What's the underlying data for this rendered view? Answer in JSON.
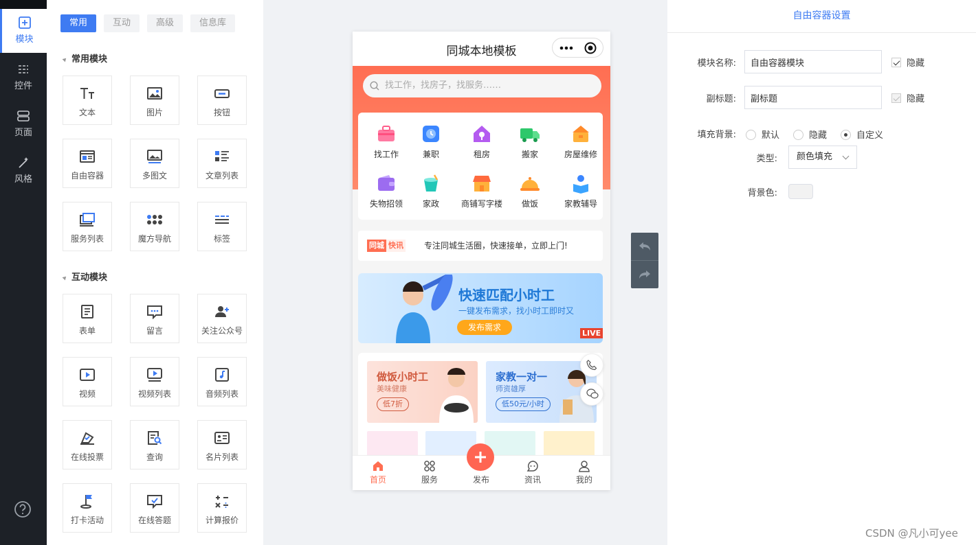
{
  "sidebar": {
    "items": [
      {
        "label": "模块",
        "icon": "plus-square-icon",
        "active": true
      },
      {
        "label": "控件",
        "icon": "sliders-icon",
        "active": false
      },
      {
        "label": "页面",
        "icon": "pages-icon",
        "active": false
      },
      {
        "label": "风格",
        "icon": "magic-wand-icon",
        "active": false
      }
    ],
    "help_icon": "help-circle-icon"
  },
  "library": {
    "tabs": [
      "常用",
      "互动",
      "高级",
      "信息库"
    ],
    "active_tab": "常用",
    "sections": [
      {
        "title": "常用模块",
        "tiles": [
          "文本",
          "图片",
          "按钮",
          "自由容器",
          "多图文",
          "文章列表",
          "服务列表",
          "魔方导航",
          "标签"
        ]
      },
      {
        "title": "互动模块",
        "tiles": [
          "表单",
          "留言",
          "关注公众号",
          "视频",
          "视频列表",
          "音频列表",
          "在线投票",
          "查询",
          "名片列表",
          "打卡活动",
          "在线答题",
          "计算报价"
        ]
      }
    ]
  },
  "phone": {
    "title": "同城本地模板",
    "search_placeholder": "找工作，找房子，找服务……",
    "categories": [
      "找工作",
      "兼职",
      "租房",
      "搬家",
      "房屋维修",
      "失物招领",
      "家政",
      "商铺写字楼",
      "做饭",
      "家教辅导"
    ],
    "news": {
      "badge_a": "同城",
      "badge_b": "快讯",
      "text": "专注同城生活圈，快速接单，立即上门!"
    },
    "banner": {
      "title": "快速匹配小时工",
      "subtitle": "一键发布需求，找小时工即时又",
      "button": "发布需求",
      "live": "LIVE"
    },
    "cards": [
      {
        "title": "做饭小时工",
        "subtitle": "美味健康",
        "badge": "低7折"
      },
      {
        "title": "家教一对一",
        "subtitle": "师资雄厚",
        "badge": "低50元/小时"
      }
    ],
    "tabbar": [
      "首页",
      "服务",
      "发布",
      "资讯",
      "我的"
    ],
    "active_tab": "首页"
  },
  "panel": {
    "title": "自由容器设置",
    "name_label": "模块名称:",
    "name_value": "自由容器模块",
    "subtitle_label": "副标题:",
    "subtitle_value": "副标题",
    "hide_label": "隐藏",
    "fill_label": "填充背景:",
    "fill_options": [
      "默认",
      "隐藏",
      "自定义"
    ],
    "fill_selected": "自定义",
    "type_label": "类型:",
    "type_value": "颜色填充",
    "bg_label": "背景色:"
  },
  "watermark": "CSDN @凡小可yee",
  "colors": {
    "accent": "#3e7bf2",
    "brand": "#ff6e52",
    "sidebar": "#1d2127"
  }
}
